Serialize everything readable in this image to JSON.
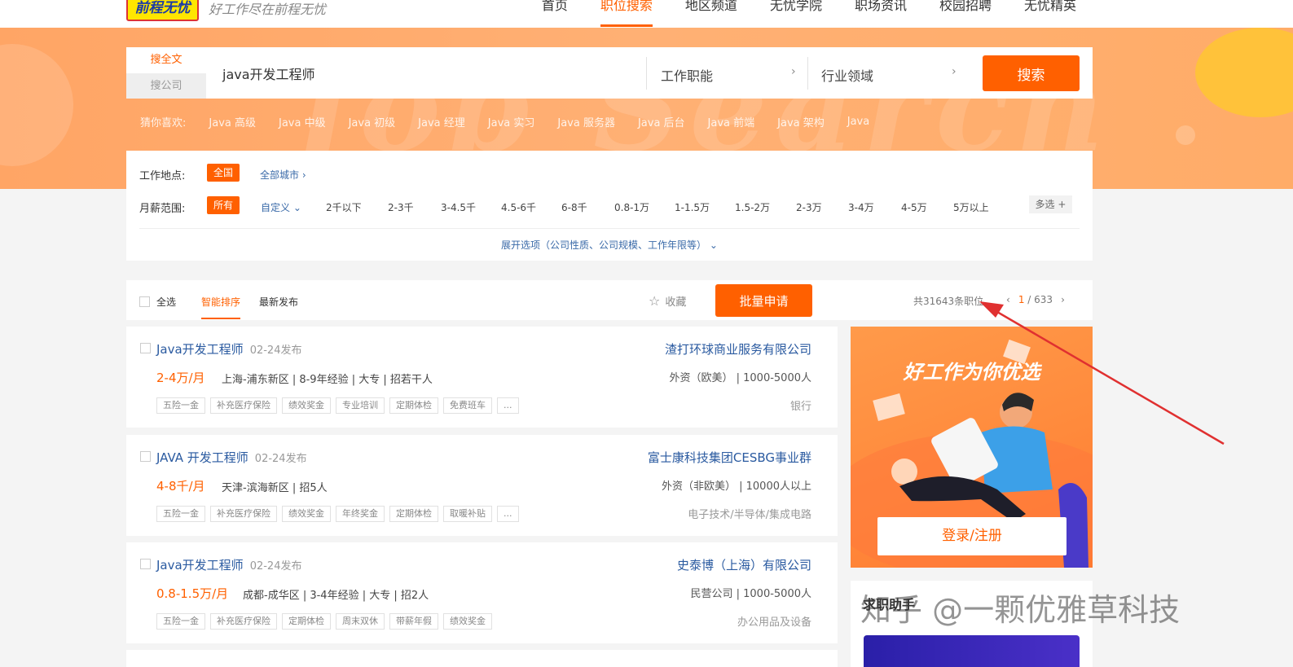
{
  "logo": {
    "text": "前程无忧"
  },
  "slogan": "好工作尽在前程无忧",
  "nav": [
    "首页",
    "职位搜索",
    "地区频道",
    "无忧学院",
    "职场资讯",
    "校园招聘",
    "无忧精英"
  ],
  "banner_ghost": "Job Search",
  "search": {
    "tab_fulltext": "搜全文",
    "tab_company": "搜公司",
    "query": "java开发工程师",
    "function": "工作职能",
    "industry": "行业领域",
    "button": "搜索"
  },
  "guess": {
    "label": "猜你喜欢:",
    "items": [
      "Java 高级",
      "Java 中级",
      "Java 初级",
      "Java 经理",
      "Java 实习",
      "Java 服务器",
      "Java 后台",
      "Java 前端",
      "Java 架构",
      "Java"
    ]
  },
  "filters": {
    "location_label": "工作地点:",
    "location_selected": "全国",
    "all_cities": "全部城市",
    "salary_label": "月薪范围:",
    "salary_selected": "所有",
    "custom": "自定义",
    "salary_options": [
      "2千以下",
      "2-3千",
      "3-4.5千",
      "4.5-6千",
      "6-8千",
      "0.8-1万",
      "1-1.5万",
      "1.5-2万",
      "2-3万",
      "3-4万",
      "4-5万",
      "5万以上"
    ],
    "multi": "多选",
    "expand": "展开选项（公司性质、公司规模、工作年限等）"
  },
  "toolbar": {
    "select_all": "全选",
    "sort_smart": "智能排序",
    "sort_newest": "最新发布",
    "favorite": "收藏",
    "batch_apply": "批量申请",
    "total": "共31643条职位",
    "page_current": "1",
    "page_sep": "/",
    "page_total": "633"
  },
  "jobs": [
    {
      "title": "Java开发工程师",
      "date": "02-24发布",
      "salary": "2-4万/月",
      "info": "上海-浦东新区 | 8-9年经验 | 大专 | 招若干人",
      "tags": [
        "五险一金",
        "补充医疗保险",
        "绩效奖金",
        "专业培训",
        "定期体检",
        "免费班车",
        "..."
      ],
      "company": "渣打环球商业服务有限公司",
      "company_info": "外资（欧美） | 1000-5000人",
      "industry": "银行"
    },
    {
      "title": "JAVA 开发工程师",
      "date": "02-24发布",
      "salary": "4-8千/月",
      "info": "天津-滨海新区 | 招5人",
      "tags": [
        "五险一金",
        "补充医疗保险",
        "绩效奖金",
        "年终奖金",
        "定期体检",
        "取暖补贴",
        "..."
      ],
      "company": "富士康科技集团CESBG事业群",
      "company_info": "外资（非欧美） | 10000人以上",
      "industry": "电子技术/半导体/集成电路"
    },
    {
      "title": "Java开发工程师",
      "date": "02-24发布",
      "salary": "0.8-1.5万/月",
      "info": "成都-成华区 | 3-4年经验 | 大专 | 招2人",
      "tags": [
        "五险一金",
        "补充医疗保险",
        "定期体检",
        "周末双休",
        "带薪年假",
        "绩效奖金"
      ],
      "company": "史泰博（上海）有限公司",
      "company_info": "民营公司 | 1000-5000人",
      "industry": "办公用品及设备"
    }
  ],
  "ad": {
    "title": "好工作为你优选",
    "login": "登录/注册"
  },
  "ad2": {
    "title": "求职助手"
  },
  "watermark": "知乎 @一颗优雅草科技",
  "colors": {
    "accent": "#ff6000",
    "link": "#2a5aa0",
    "banner": "#ffa565",
    "annotation_arrow": "#e03030"
  }
}
